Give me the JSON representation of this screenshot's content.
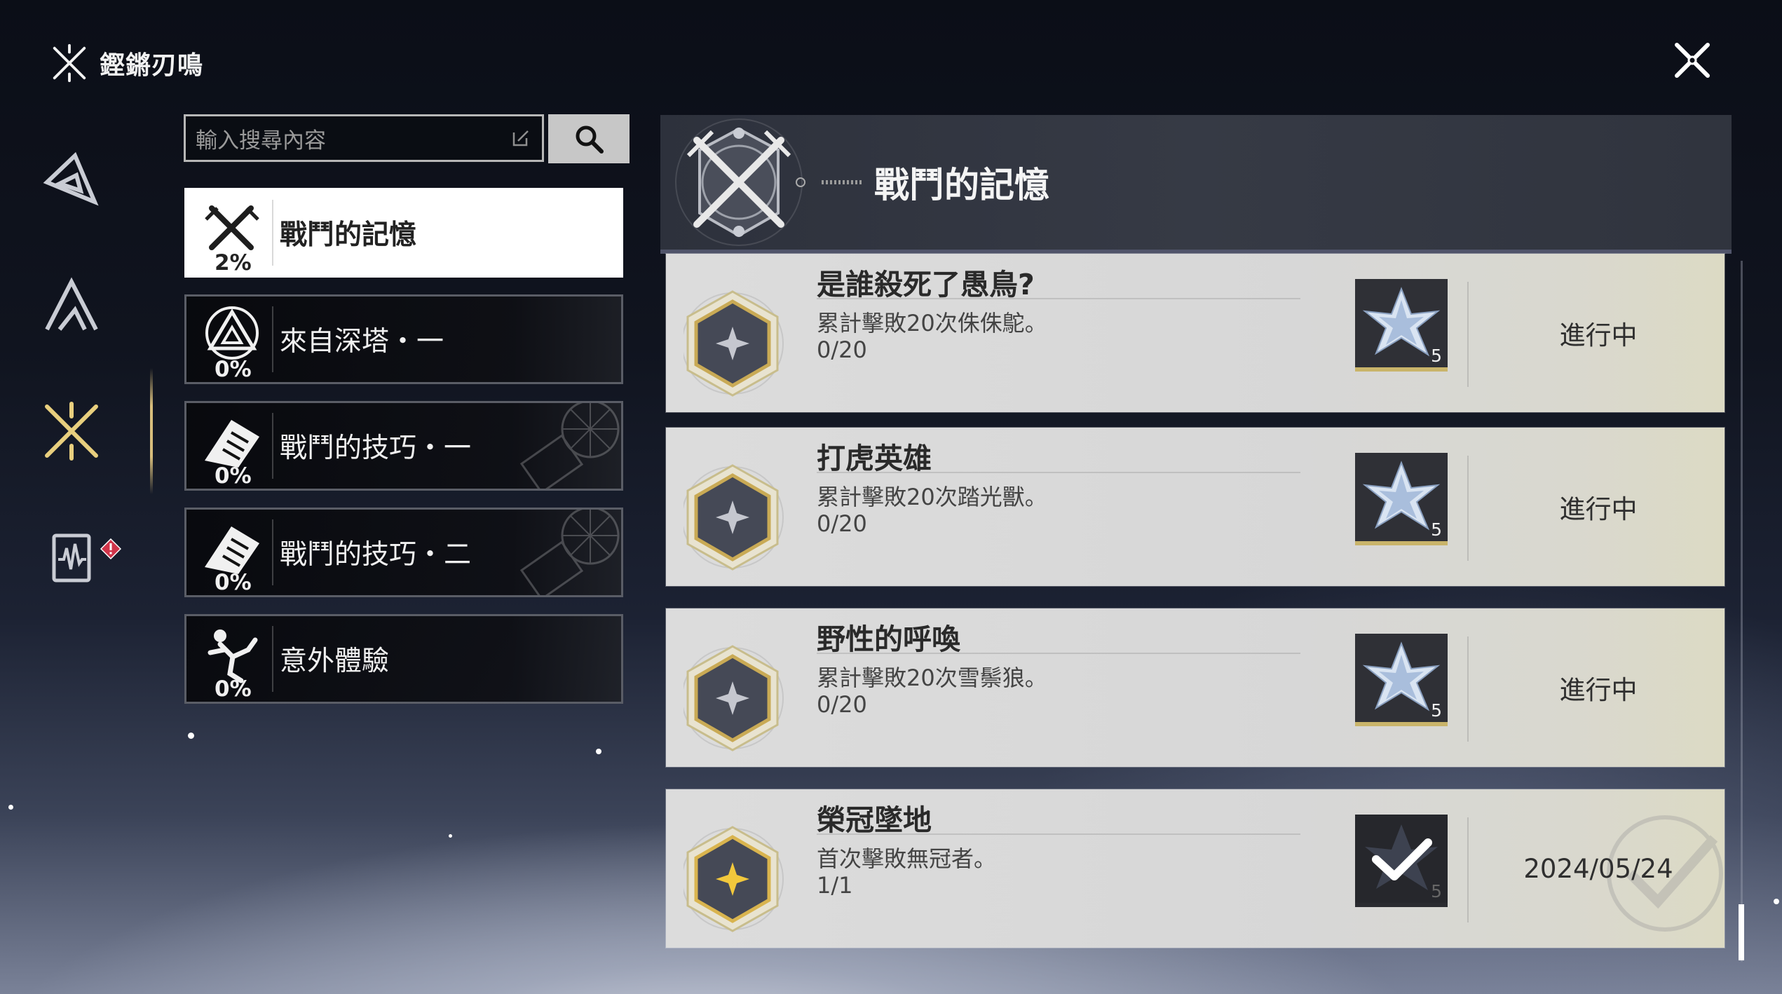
{
  "app": {
    "title": "鏗鏘刃鳴"
  },
  "colors": {
    "accent_gold": "#d8be7c",
    "badge_red": "#d0344a",
    "card_bg": "#dcdcdc"
  },
  "rail": [
    {
      "icon": "triangle-sigil-icon",
      "selected": false
    },
    {
      "icon": "mountain-sigil-icon",
      "selected": false
    },
    {
      "icon": "crossed-swords-icon",
      "selected": true
    },
    {
      "icon": "waveform-card-icon",
      "selected": false,
      "alert": "!"
    }
  ],
  "search": {
    "placeholder": "輸入搜尋內容"
  },
  "categories": [
    {
      "name": "戰鬥的記憶",
      "percent": "2%",
      "icon": "crossed-swords-icon",
      "active": true
    },
    {
      "name": "來自深塔・一",
      "percent": "0%",
      "icon": "tower-triangle-icon",
      "active": false
    },
    {
      "name": "戰鬥的技巧・一",
      "percent": "0%",
      "icon": "fist-icon",
      "active": false
    },
    {
      "name": "戰鬥的技巧・二",
      "percent": "0%",
      "icon": "fist-icon",
      "active": false
    },
    {
      "name": "意外體驗",
      "percent": "0%",
      "icon": "falling-figure-icon",
      "active": false
    }
  ],
  "banner": {
    "title": "戰鬥的記憶"
  },
  "achievements": [
    {
      "title": "是誰殺死了愚鳥?",
      "desc": "累計擊敗20次侏侏鴕。",
      "progress": "0/20",
      "reward_count": "5",
      "status": "進行中",
      "completed": false
    },
    {
      "title": "打虎英雄",
      "desc": "累計擊敗20次踏光獸。",
      "progress": "0/20",
      "reward_count": "5",
      "status": "進行中",
      "completed": false
    },
    {
      "title": "野性的呼喚",
      "desc": "累計擊敗20次雪鬃狼。",
      "progress": "0/20",
      "reward_count": "5",
      "status": "進行中",
      "completed": false
    },
    {
      "title": "榮冠墜地",
      "desc": "首次擊敗無冠者。",
      "progress": "1/1",
      "reward_count": "5",
      "status": "2024/05/24",
      "completed": true
    }
  ]
}
